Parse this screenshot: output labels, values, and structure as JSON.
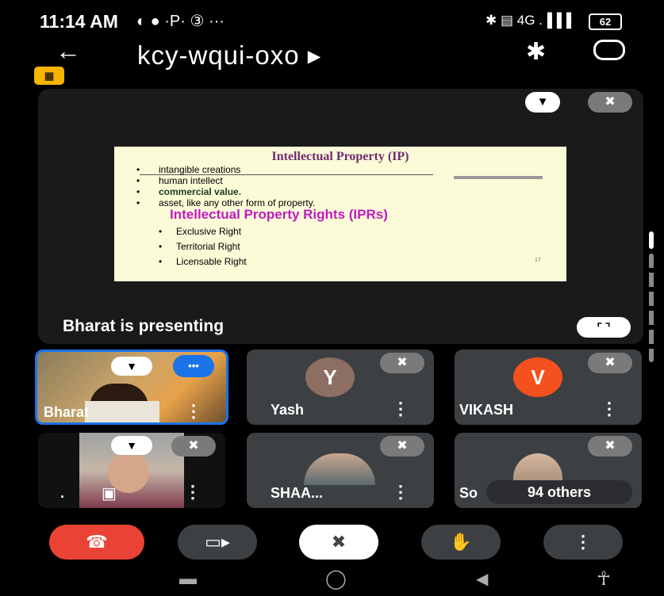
{
  "status_bar": {
    "time": "11:14 AM",
    "extra_icons": "◐ ● ·P· ③ ···",
    "right_icons": "✱ ▤ 4G .▐▐▐",
    "battery": "62"
  },
  "header": {
    "back_glyph": "←",
    "meeting_code": "kcy-wqui-oxo ▸",
    "bluetooth_glyph": "✱",
    "rec_glyph": "▦"
  },
  "presentation": {
    "slide_title": "Intellectual Property (IP)",
    "bullets": [
      "intangible creations",
      "human intellect",
      "commercial value.",
      "asset, like any other form of property."
    ],
    "bullet_glyph": "•",
    "subtitle": "Intellectual Property Rights (IPRs)",
    "rights": [
      "Exclusive Right",
      "Territorial Right",
      "Licensable Right"
    ],
    "page_mark": "17",
    "presenting_label": "Bharat is presenting",
    "pin_glyph": "▼",
    "mute_glyph": "✖",
    "fullscreen_glyph": "⌜ ⌝"
  },
  "participants": [
    {
      "name": "Bharat"
    },
    {
      "name": "Yash",
      "initial": "Y"
    },
    {
      "name": "VIKASH",
      "initial": "V"
    },
    {
      "name": "."
    },
    {
      "name": "SHAA..."
    },
    {
      "name": "So",
      "others": "94 others"
    }
  ],
  "tile_glyphs": {
    "more": "⋮",
    "pin": "▼",
    "mute": "✖",
    "speaking": "•••",
    "present": "▣"
  },
  "controls": {
    "end_call": "☎",
    "camera": "▭▸",
    "mic": "✖",
    "raise_hand": "✋",
    "more": "⋮"
  },
  "nav": {
    "square": "▬",
    "home": "◯",
    "back": "◀",
    "accessibility": "☥"
  },
  "colors": {
    "tile": "#3c4043",
    "end_call": "#ea4335",
    "active_border": "#1a73e8",
    "yash_avatar": "#8d6e63",
    "vikash_avatar": "#f4511e"
  }
}
